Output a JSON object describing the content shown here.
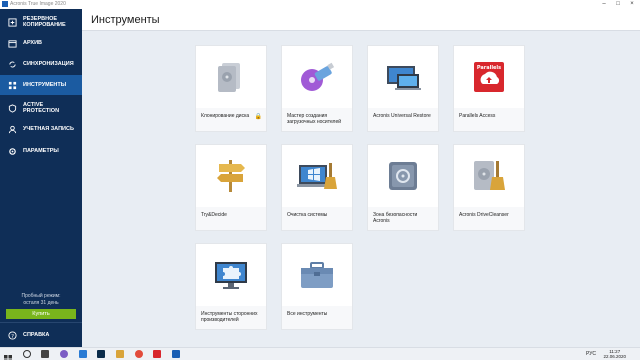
{
  "window": {
    "title": "Acronis True Image 2020"
  },
  "sidebar": {
    "items": [
      {
        "label": "РЕЗЕРВНОЕ КОПИРОВАНИЕ",
        "icon": "backup-icon"
      },
      {
        "label": "АРХИВ",
        "icon": "archive-icon"
      },
      {
        "label": "СИНХРОНИЗАЦИЯ",
        "icon": "sync-icon"
      },
      {
        "label": "ИНСТРУМЕНТЫ",
        "icon": "tools-icon",
        "active": true
      },
      {
        "label": "ACTIVE PROTECTION",
        "icon": "shield-icon"
      },
      {
        "label": "УЧЕТНАЯ ЗАПИСЬ",
        "icon": "user-icon"
      },
      {
        "label": "ПАРАМЕТРЫ",
        "icon": "gear-icon"
      }
    ],
    "trial_line1": "Пробный режим:",
    "trial_line2": "осталя 31 день",
    "buy_label": "Купить",
    "help_label": "СПРАВКА"
  },
  "main": {
    "title": "Инструменты",
    "tiles": [
      {
        "label": "Клонирование диска",
        "icon": "disk-clone-icon",
        "locked": true
      },
      {
        "label": "Мастер создания загрузочных носителей",
        "icon": "usb-media-icon"
      },
      {
        "label": "Acronis Universal Restore",
        "icon": "universal-restore-icon"
      },
      {
        "label": "Parallels Access",
        "icon": "parallels-access-icon",
        "badge": "Parallels"
      },
      {
        "label": "Try&Decide",
        "icon": "signpost-icon"
      },
      {
        "label": "Очистка системы",
        "icon": "system-cleanup-icon"
      },
      {
        "label": "Зона безопасности Acronis",
        "icon": "safe-icon"
      },
      {
        "label": "Acronis DriveCleanser",
        "icon": "drive-cleanser-icon"
      },
      {
        "label": "Инструменты сторонних производителей",
        "icon": "puzzle-icon"
      },
      {
        "label": "Все инструменты",
        "icon": "toolbox-icon"
      }
    ]
  },
  "taskbar": {
    "lang": "РУС",
    "time": "11:27",
    "date": "22.06.2020"
  },
  "colors": {
    "sidebar": "#0f2e57",
    "active": "#1b5ba1",
    "buy": "#79b51c",
    "brand": "#1a5fb4"
  }
}
